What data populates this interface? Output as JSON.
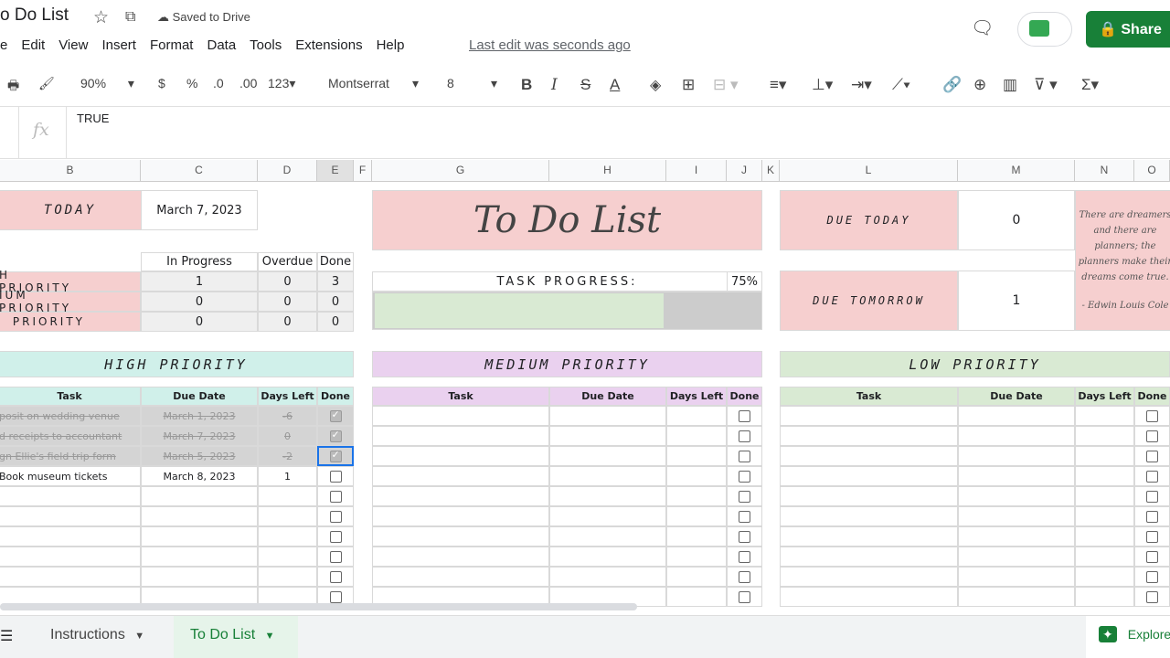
{
  "header": {
    "title": "o Do List",
    "saved": "Saved to Drive",
    "share": "Share",
    "last_edit": "Last edit was seconds ago"
  },
  "menu": [
    "e",
    "Edit",
    "View",
    "Insert",
    "Format",
    "Data",
    "Tools",
    "Extensions",
    "Help"
  ],
  "toolbar": {
    "zoom": "90%",
    "currency": "$",
    "percent": "%",
    "dec_less": ".0",
    "dec_more": ".00",
    "format": "123",
    "font": "Montserrat",
    "size": "8"
  },
  "formula": {
    "value": "TRUE"
  },
  "columns": [
    "B",
    "C",
    "D",
    "E",
    "F",
    "G",
    "H",
    "I",
    "J",
    "K",
    "L",
    "M",
    "N",
    "O"
  ],
  "today": {
    "label": "TODAY",
    "date": "March 7, 2023"
  },
  "stats": {
    "headers": [
      "In Progress",
      "Overdue",
      "Done"
    ],
    "rows": [
      {
        "label": "H PRIORITY",
        "values": [
          "1",
          "0",
          "3"
        ]
      },
      {
        "label": "IUM PRIORITY",
        "values": [
          "0",
          "0",
          "0"
        ]
      },
      {
        "label": "PRIORITY",
        "values": [
          "0",
          "0",
          "0"
        ]
      }
    ]
  },
  "main_title": "To Do List",
  "progress": {
    "label": "TASK PROGRESS:",
    "value_text": "75%",
    "value": 0.75,
    "fill": "#d9ead3"
  },
  "due": {
    "today_label": "DUE TODAY",
    "today_value": "0",
    "tomorrow_label": "DUE TOMORROW",
    "tomorrow_value": "1"
  },
  "quote": {
    "text": "There are dreamers and there are planners; the planners make their dreams come true.",
    "author": "- Edwin Louis Cole"
  },
  "sections": [
    {
      "title": "HIGH PRIORITY",
      "color": "#d0f0ea",
      "headers": [
        "Task",
        "Due Date",
        "Days Left",
        "Done"
      ],
      "tasks": [
        {
          "task": "posit on wedding venue",
          "due": "March 1, 2023",
          "days": "-6",
          "done": true
        },
        {
          "task": "d receipts to accountant",
          "due": "March 7, 2023",
          "days": "0",
          "done": true
        },
        {
          "task": "gn Ellie's field trip form",
          "due": "March 5, 2023",
          "days": "-2",
          "done": true
        },
        {
          "task": "Book museum tickets",
          "due": "March 8, 2023",
          "days": "1",
          "done": false
        }
      ]
    },
    {
      "title": "MEDIUM PRIORITY",
      "color": "#ead1ef",
      "headers": [
        "Task",
        "Due Date",
        "Days Left",
        "Done"
      ],
      "tasks": []
    },
    {
      "title": "LOW PRIORITY",
      "color": "#d9ead3",
      "headers": [
        "Task",
        "Due Date",
        "Days Left",
        "Done"
      ],
      "tasks": []
    }
  ],
  "tabs": {
    "instructions": "Instructions",
    "todo": "To Do List",
    "explore": "Explore"
  }
}
